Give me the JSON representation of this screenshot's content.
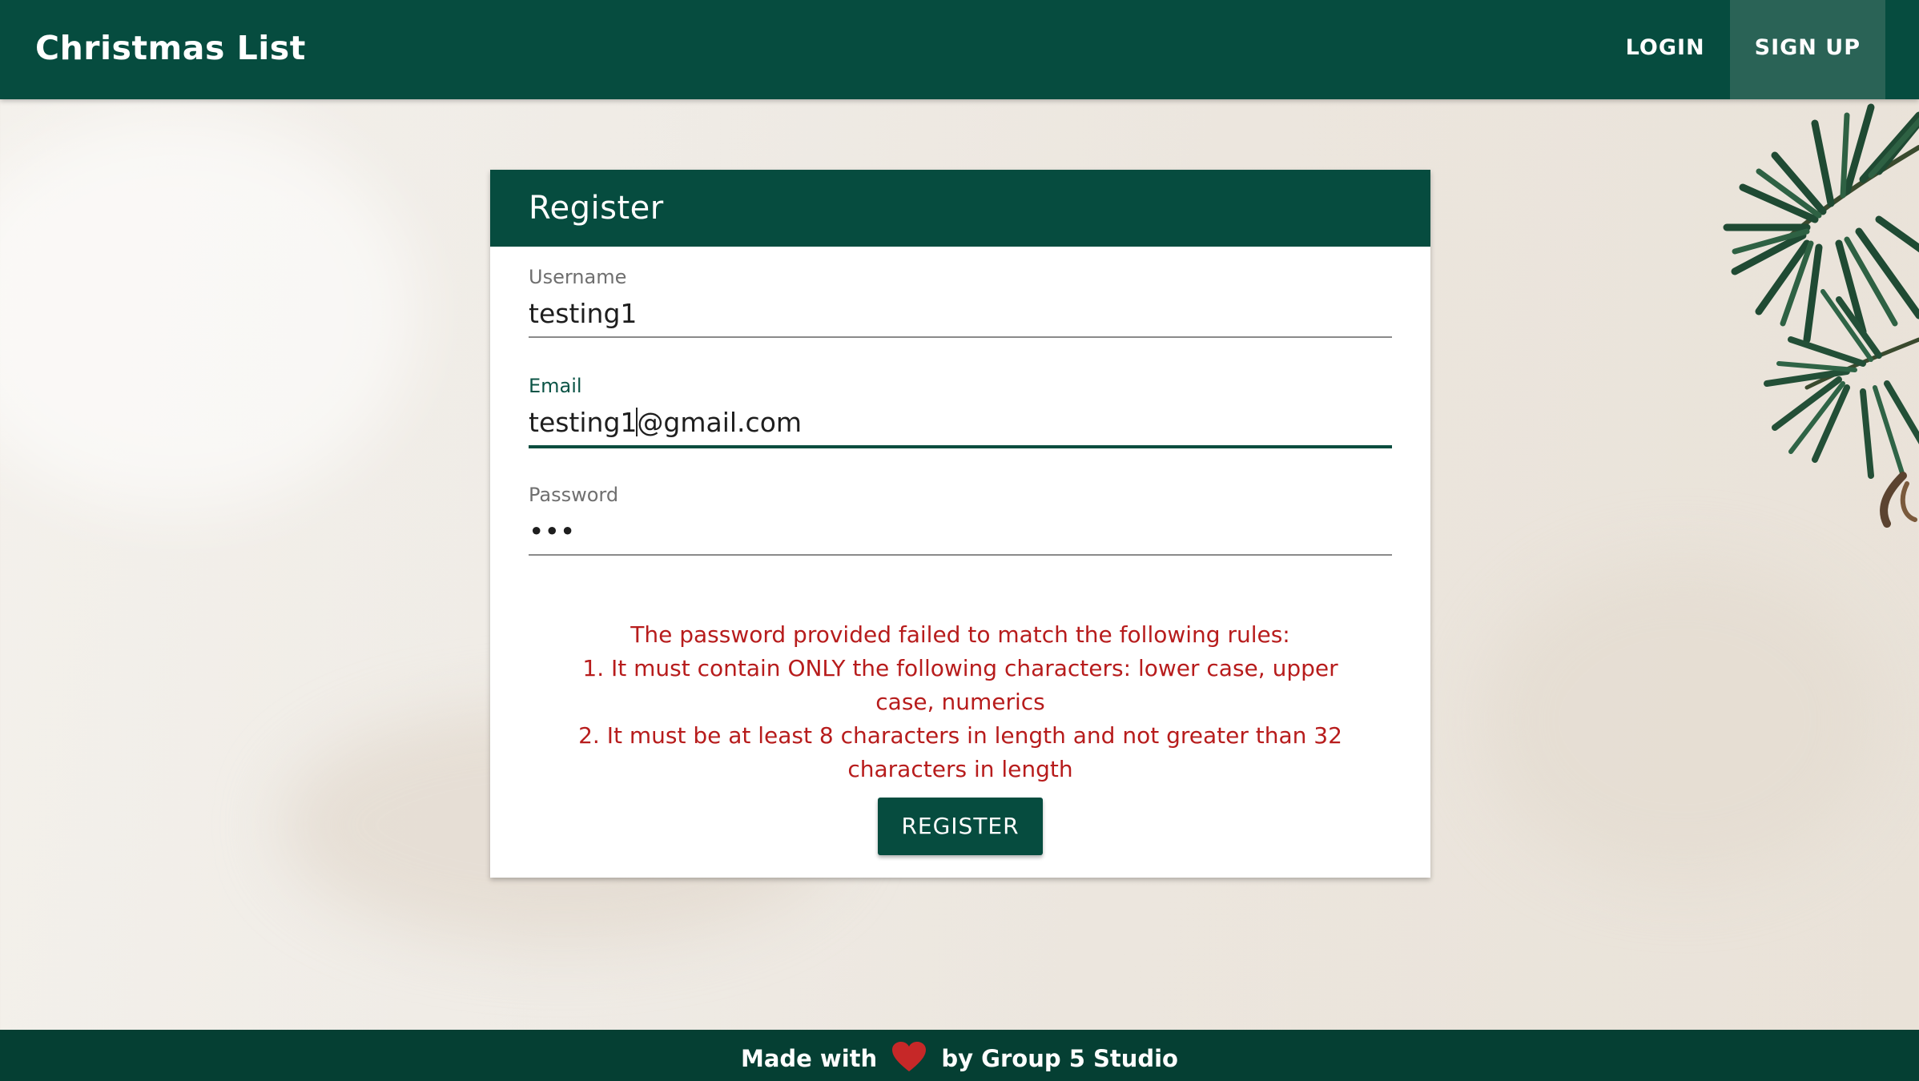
{
  "header": {
    "brand": "Christmas List",
    "nav": [
      {
        "label": "LOGIN",
        "active": false
      },
      {
        "label": "SIGN UP",
        "active": true
      }
    ]
  },
  "form": {
    "title": "Register",
    "username": {
      "label": "Username",
      "value": "testing1"
    },
    "email": {
      "label": "Email",
      "value_before_caret": "testing1",
      "value_after_caret": "@gmail.com"
    },
    "password": {
      "label": "Password",
      "value": "•••"
    },
    "error": {
      "intro": "The password provided failed to match the following rules:",
      "rule1": "1. It must contain ONLY the following characters: lower case, upper case, numerics",
      "rule2": "2. It must be at least 8 characters in length and not greater than 32 characters in length"
    },
    "submit_label": "REGISTER"
  },
  "footer": {
    "before": "Made with",
    "after": "by Group 5 Studio",
    "icon": "heart-icon"
  },
  "colors": {
    "primary": "#064c3f",
    "active_nav": "#2a6356",
    "error": "#b71c1c",
    "heart": "#c62828"
  }
}
